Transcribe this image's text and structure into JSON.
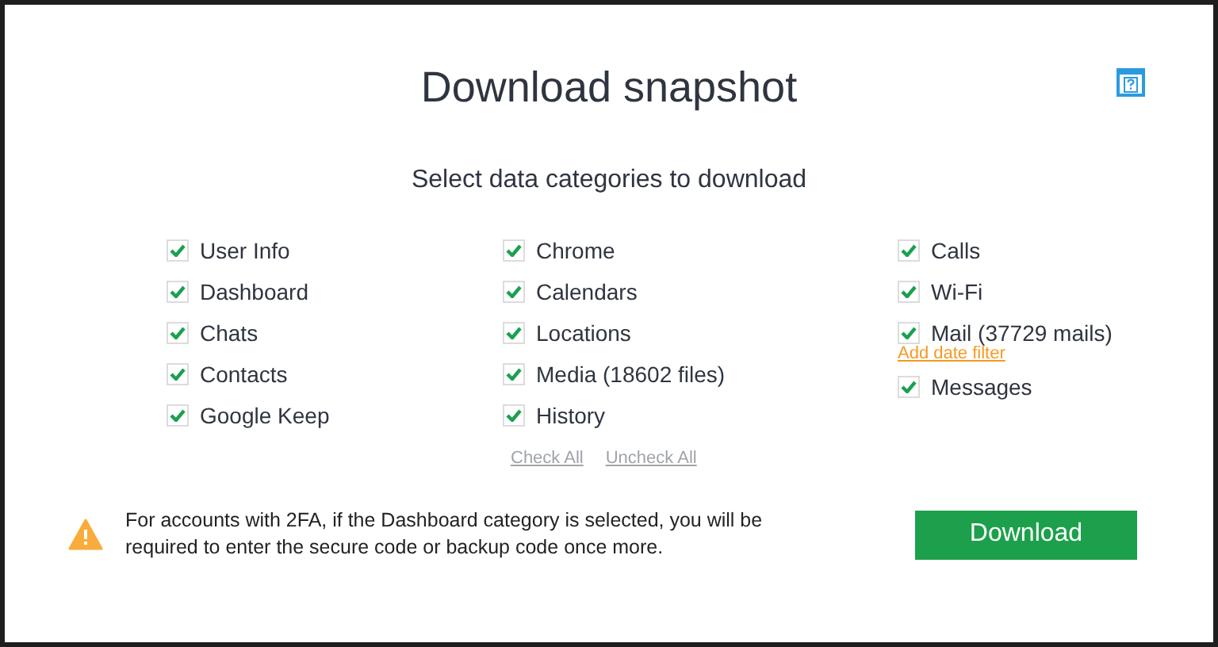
{
  "title": "Download snapshot",
  "subtitle": "Select data categories to download",
  "columns": [
    {
      "items": [
        {
          "label": "User Info",
          "checked": true
        },
        {
          "label": "Dashboard",
          "checked": true
        },
        {
          "label": "Chats",
          "checked": true
        },
        {
          "label": "Contacts",
          "checked": true
        },
        {
          "label": "Google Keep",
          "checked": true
        }
      ]
    },
    {
      "items": [
        {
          "label": "Chrome",
          "checked": true
        },
        {
          "label": "Calendars",
          "checked": true
        },
        {
          "label": "Locations",
          "checked": true
        },
        {
          "label": "Media (18602 files)",
          "checked": true
        },
        {
          "label": "History",
          "checked": true
        }
      ],
      "links": [
        "Check All",
        "Uncheck All"
      ]
    },
    {
      "items": [
        {
          "label": "Calls",
          "checked": true
        },
        {
          "label": "Wi-Fi",
          "checked": true
        },
        {
          "label": "Mail (37729 mails)",
          "checked": true,
          "link": "Add date filter"
        },
        {
          "label": "Messages",
          "checked": true
        }
      ]
    }
  ],
  "warning": "For accounts with 2FA, if the Dashboard category is selected, you will be required to enter the secure code or backup code once more.",
  "download_button": "Download"
}
